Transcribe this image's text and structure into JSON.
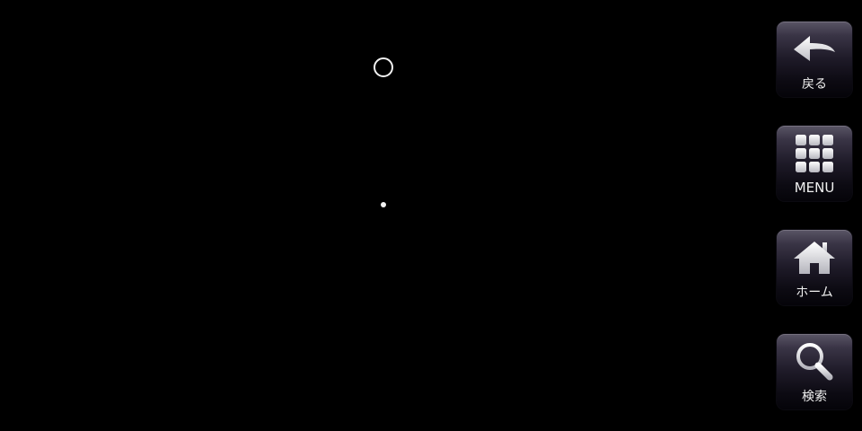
{
  "nav": {
    "items": [
      {
        "id": "back",
        "label": "戻る",
        "icon": "back-arrow-icon"
      },
      {
        "id": "menu",
        "label": "MENU",
        "icon": "grid-menu-icon"
      },
      {
        "id": "home",
        "label": "ホーム",
        "icon": "house-icon"
      },
      {
        "id": "search",
        "label": "検索",
        "icon": "magnifier-icon"
      }
    ]
  },
  "colors": {
    "background": "#000000",
    "button_top": "#5a5566",
    "button_bottom": "#050409",
    "label": "#f0f0f0",
    "icon": "#e8e8e8"
  }
}
